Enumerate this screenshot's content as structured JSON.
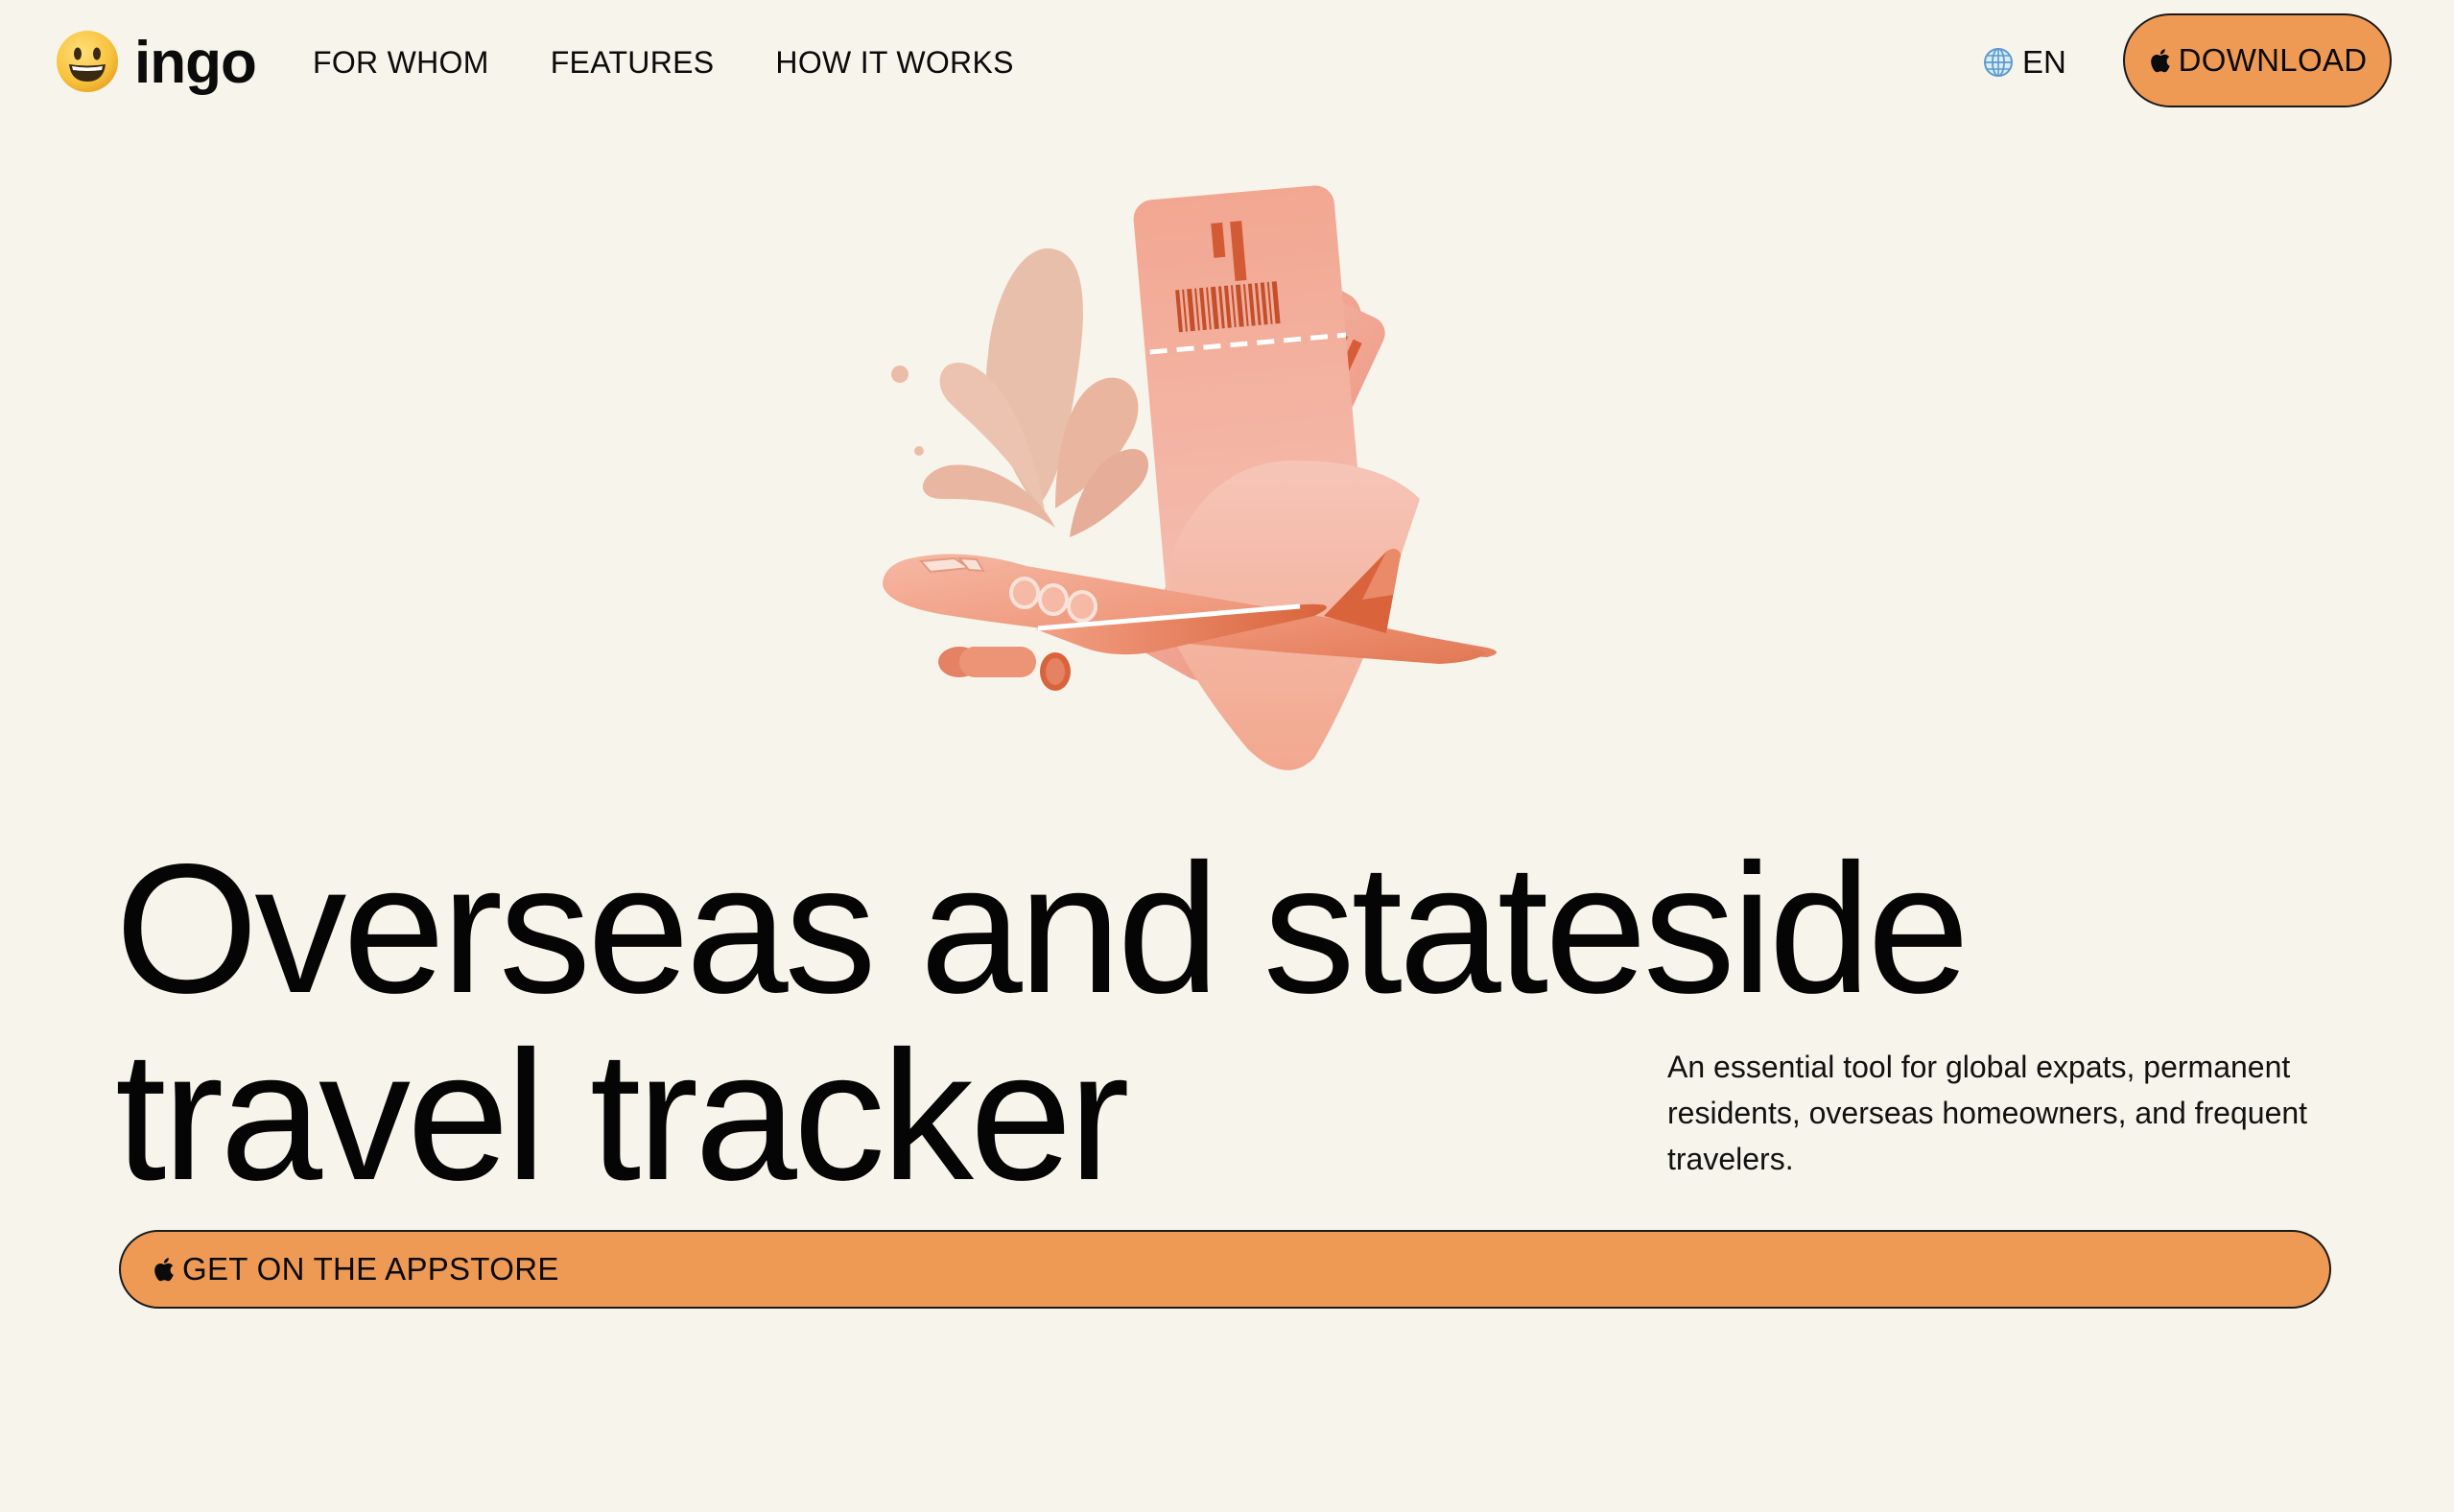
{
  "brand": {
    "name": "ingo"
  },
  "nav": {
    "items": [
      {
        "label": "FOR WHOM"
      },
      {
        "label": "FEATURES"
      },
      {
        "label": "HOW IT WORKS"
      }
    ]
  },
  "language": {
    "label": "EN",
    "icon": "globe-icon"
  },
  "header": {
    "download_label": "DOWNLOAD",
    "download_icon": "apple-icon"
  },
  "hero": {
    "headline_line1": "Overseas and stateside",
    "headline_line2": "travel tracker",
    "subtitle": "An essential tool for global expats, permanent residents, overseas homeowners, and frequent travelers.",
    "cta_label": "GET ON THE APPSTORE",
    "cta_icon": "apple-icon",
    "illustration": "plane-and-tickets-illustration"
  },
  "colors": {
    "background": "#f7f4eb",
    "accent": "#ef9a54",
    "text": "#0b0b0b",
    "illustration_main": "#f0a089",
    "illustration_dark": "#d9643c",
    "illustration_light": "#f6c4b6"
  }
}
